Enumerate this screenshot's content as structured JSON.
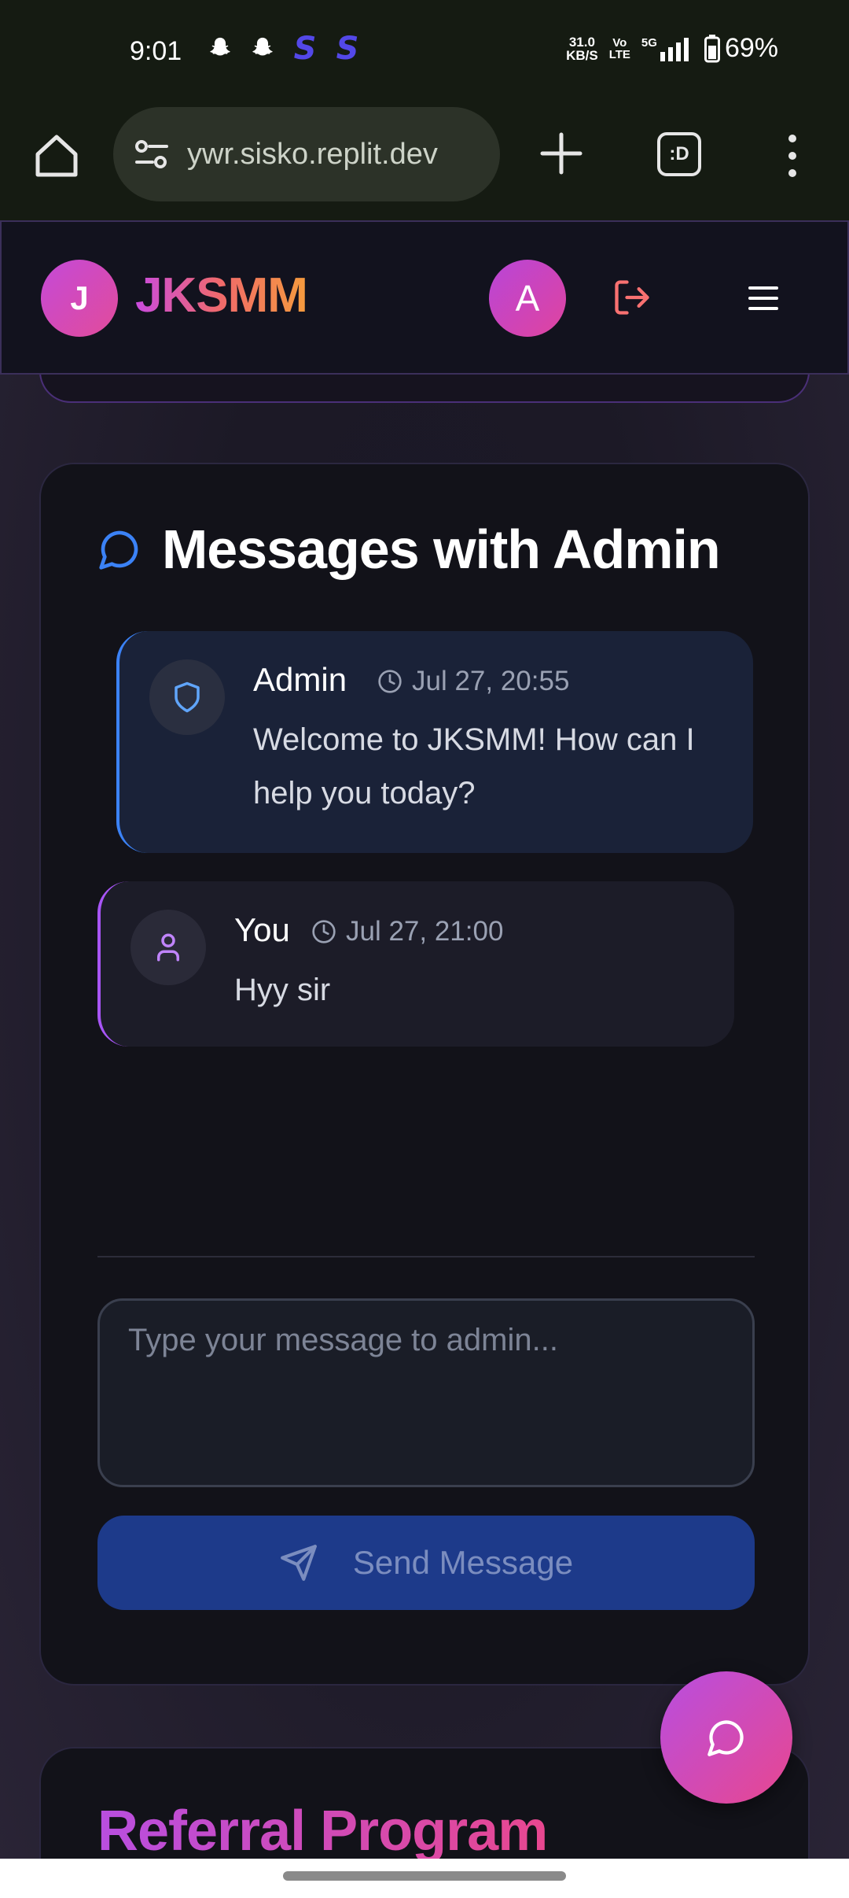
{
  "status_bar": {
    "time": "9:01",
    "net_speed_value": "31.0",
    "net_speed_unit": "KB/S",
    "volte_line1": "Vo",
    "volte_line2": "LTE",
    "network": "5G",
    "battery": "69%"
  },
  "browser": {
    "url": "ywr.sisko.replit.dev",
    "tabs_label": ":D"
  },
  "header": {
    "logo_letter": "J",
    "brand": "JKSMM",
    "user_initial": "A"
  },
  "messages_card": {
    "title": "Messages with Admin",
    "messages": [
      {
        "sender": "Admin",
        "time": "Jul 27, 20:55",
        "text_line1": "Welcome to JKSMM! How can I",
        "text_line2": "help you today?",
        "accent": "#3b82f6"
      },
      {
        "sender": "You",
        "time": "Jul 27, 21:00",
        "text_line1": "Hyy sir",
        "accent": "#a855f7"
      }
    ],
    "input_placeholder": "Type your message to admin...",
    "send_label": "Send Message"
  },
  "referral": {
    "title": "Referral Program"
  },
  "colors": {
    "brand_gradient_start": "#c94be0",
    "brand_gradient_end": "#f59b3d",
    "send_button": "#1d3a8a"
  }
}
